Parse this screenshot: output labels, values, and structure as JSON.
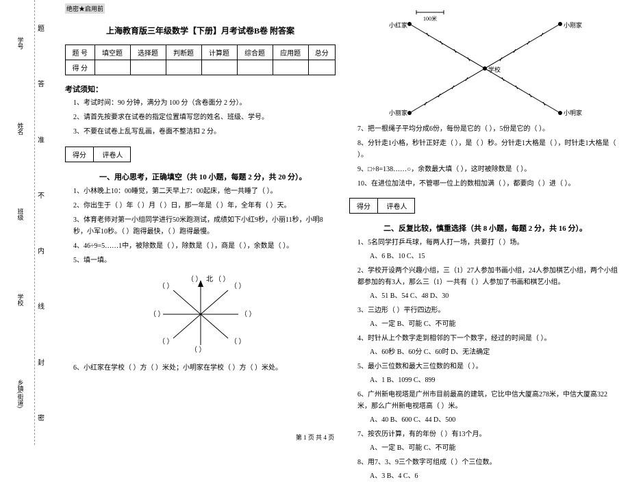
{
  "sidebar": {
    "labels": [
      "学号",
      "姓名",
      "班级",
      "学校",
      "乡镇(街道)"
    ],
    "vert_labels": [
      "答",
      "准",
      "不",
      "内",
      "线",
      "封",
      "密"
    ],
    "dotted_label": "题"
  },
  "header": {
    "confidential": "绝密★启用前",
    "title": "上海教育版三年级数学【下册】月考试卷B卷 附答案"
  },
  "score_table": {
    "row1": [
      "题    号",
      "填空题",
      "选择题",
      "判断题",
      "计算题",
      "综合题",
      "应用题",
      "总分"
    ],
    "row2": [
      "得    分",
      "",
      "",
      "",
      "",
      "",
      "",
      ""
    ]
  },
  "notice": {
    "title": "考试须知：",
    "items": [
      "1、考试时间：90 分钟，满分为 100 分（含卷面分 2 分）。",
      "2、请首先按要求在试卷的指定位置填写您的姓名、班级、学号。",
      "3、不要在试卷上乱写乱画，卷面不整洁扣 2 分。"
    ]
  },
  "score_box": {
    "c1": "得分",
    "c2": "评卷人"
  },
  "section1": {
    "title": "一、用心思考，正确填空（共 10 小题，每题 2 分，共 20 分）。",
    "q1": "1、小林晚上10：00睡觉，第二天早上7：00起床，他一共睡了（      ）。",
    "q2": "2、你出生于（      ）年（      ）月（      ）日，那一年是（      ）年，全年有（      ）天。",
    "q3": "3、体育老师对第一小组同学进行50米跑测试，成绩如下小红9秒，小丽11秒，小明8秒，小军10秒。（      ）跑得最快，（      ）跑得最慢。",
    "q4": "4、46÷9=5……1中，被除数是（      ），除数是（      ），商是（      ），余数是（      ）。",
    "q5": "5、填一填。",
    "q5_north": "北",
    "q6": "6、小红家在学校（      ）方（      ）米处；小明家在学校（      ）方（      ）米处。",
    "q7": "7、把一根绳子平均分成6份，每份是它的（      ），5份是它的（      ）。",
    "q8": "8、分针走1小格，秒针正好走（      ），是（      ）秒。分针走1大格是（      ），时针走1大格是（      ）。",
    "q9": "9、□÷8=138……○，余数最大填（      ），这时被除数是（      ）。",
    "q10": "10、在进位加法中，不管哪一位上的数相加满（      ），都要向（      ）进（      ）。"
  },
  "section2": {
    "title": "二、反复比较，慎重选择（共 8 小题，每题 2 分，共 16 分）。",
    "q1": "1、5名同学打乒乓球，每两人打一场，共要打（      ）场。",
    "q1_opts": "A、6            B、10            C、15",
    "q2": "2、学校开设两个兴趣小组，三（1）27人参加书画小组，24人参加棋艺小组，两个小组都参加的有3人，那么三（1）一共有（      ）人参加了书画和棋艺小组。",
    "q2_opts": "A、51          B、54          C、48          D、30",
    "q3": "3、三边形（      ）平行四边形。",
    "q3_opts": "A、一定          B、可能          C、不可能",
    "q4": "4、时针从上个数字走到相邻的下一个数字，经过的时间是（      ）。",
    "q4_opts": "A、60秒        B、60分        C、60时        D、无法确定",
    "q5": "5、最小三位数和最大三位数的和是（      ）。",
    "q5_opts": "A、1          B、1099          C、899",
    "q6": "6、广州新电视塔是广州市目前最高的建筑，它比中信大厦高278米，中信大厦高322米，那么广州新电视塔高（      ）米。",
    "q6_opts": "A、40          B、600          C、44          D、500",
    "q7": "7、按农历计算，有的年份（      ）有13个月。",
    "q7_opts": "A、一定          B、可能          C、不可能",
    "q8": "8、用7、3、9三个数字可组成（      ）个三位数。",
    "q8_opts": "A、3            B、4            C、6"
  },
  "diagram": {
    "scale": "100米",
    "label_school": "学校",
    "label_xiaohong": "小红家",
    "label_xiaoming": "小明家",
    "label_xiaogang": "小刚家",
    "label_xiaoli": "小丽家"
  },
  "footer": "第 1 页 共 4 页"
}
